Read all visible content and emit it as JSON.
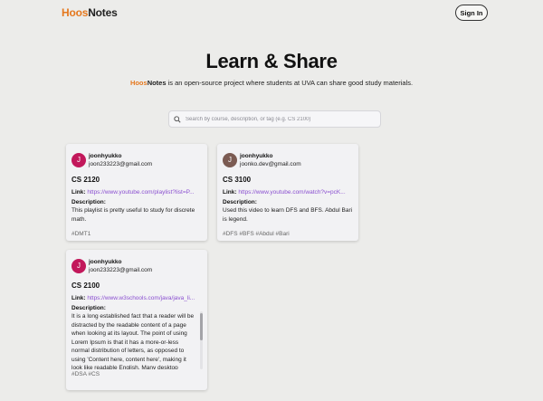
{
  "nav": {
    "logo_part1": "Hoos",
    "logo_part2": "Notes",
    "signin_label": "Sign In"
  },
  "hero": {
    "title": "Learn & Share",
    "subtitle_brand1": "Hoos",
    "subtitle_brand2": "Notes",
    "subtitle_rest": " is an open-source project where students at UVA can share good study materials."
  },
  "search": {
    "placeholder": "Search by course, description, or tag (e.g. CS 2100)",
    "value": ""
  },
  "colors": {
    "brand_orange": "#e5781e",
    "link_purple": "#8a4fd0",
    "avatar_pink": "#c2185b",
    "avatar_brown": "#7b5b52"
  },
  "cards": [
    {
      "avatar_letter": "J",
      "avatar_color": "#c2185b",
      "username": "joonhyukko",
      "email": "joon233223@gmail.com",
      "course": "CS 2120",
      "link_label": "Link:",
      "link_text": "https://www.youtube.com/playlist?list=P...",
      "desc_label": "Description:",
      "description": "This playlist is pretty useful to study for discrete math.",
      "tags": "#DMT1"
    },
    {
      "avatar_letter": "J",
      "avatar_color": "#7b5b52",
      "username": "joonhyukko",
      "email": "joonko.dev@gmail.com",
      "course": "CS 3100",
      "link_label": "Link:",
      "link_text": "https://www.youtube.com/watch?v=pcK...",
      "desc_label": "Description:",
      "description": "Used this video to learn DFS and BFS. Abdul Bari is legend.",
      "tags": "#DFS #BFS #Abdul #Bari"
    },
    {
      "avatar_letter": "J",
      "avatar_color": "#c2185b",
      "username": "joonhyukko",
      "email": "joon233223@gmail.com",
      "course": "CS 2100",
      "link_label": "Link:",
      "link_text": "https://www.w3schools.com/java/java_li...",
      "desc_label": "Description:",
      "description": "It is a long established fact that a reader will be distracted by the readable content of a page when looking at its layout. The point of using Lorem Ipsum is that it has a more-or-less normal distribution of letters, as opposed to using 'Content here, content here', making it look like readable English. Many desktop publishing packages and web page editors now use Lorem Ipsum.",
      "tags": "#DSA #CS"
    }
  ]
}
